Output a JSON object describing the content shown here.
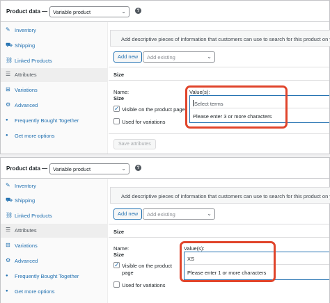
{
  "panels": [
    {
      "title": "Product data —",
      "product_type": "Variable product",
      "tabs": [
        {
          "icon": "wrench-icon",
          "glyph": "✎",
          "label": "Inventory"
        },
        {
          "icon": "truck-icon",
          "glyph": "⛟",
          "label": "Shipping"
        },
        {
          "icon": "link-icon",
          "glyph": "🔗",
          "label": "Linked Products"
        },
        {
          "icon": "list-icon",
          "glyph": "☰",
          "label": "Attributes"
        },
        {
          "icon": "grid-icon",
          "glyph": "⊞",
          "label": "Variations"
        },
        {
          "icon": "gear-icon",
          "glyph": "⚙",
          "label": "Advanced"
        },
        {
          "icon": "plugin-icon",
          "glyph": "⬤",
          "label": "Frequently Bought Together"
        },
        {
          "icon": "plugin-icon",
          "glyph": "⬤",
          "label": "Get more options"
        }
      ],
      "info_text": "Add descriptive pieces of information that customers can use to search for this product on your",
      "add_new": "Add new",
      "add_existing_placeholder": "Add existing",
      "section_title": "Size",
      "name_label": "Name:",
      "name_value": "Size",
      "visible_label": "Visible on the product page",
      "visible_checked": true,
      "variations_label": "Used for variations",
      "variations_checked": false,
      "values_label": "Value(s):",
      "values_input": "Select terms",
      "values_hint": "Please enter 3 or more characters",
      "save_label": "Save attributes"
    },
    {
      "title": "Product data —",
      "product_type": "Variable product",
      "tabs": [
        {
          "icon": "wrench-icon",
          "glyph": "✎",
          "label": "Inventory"
        },
        {
          "icon": "truck-icon",
          "glyph": "⛟",
          "label": "Shipping"
        },
        {
          "icon": "link-icon",
          "glyph": "🔗",
          "label": "Linked Products"
        },
        {
          "icon": "list-icon",
          "glyph": "☰",
          "label": "Attributes"
        },
        {
          "icon": "grid-icon",
          "glyph": "⊞",
          "label": "Variations"
        },
        {
          "icon": "gear-icon",
          "glyph": "⚙",
          "label": "Advanced"
        },
        {
          "icon": "plugin-icon",
          "glyph": "⬤",
          "label": "Frequently Bought Together"
        },
        {
          "icon": "plugin-icon",
          "glyph": "⬤",
          "label": "Get more options"
        }
      ],
      "info_text": "Add descriptive pieces of information that customers can use to search for this product on your",
      "add_new": "Add new",
      "add_existing_placeholder": "Add existing",
      "section_title": "Size",
      "name_label": "Name:",
      "name_value": "Size",
      "visible_label_line1": "Visible on the product",
      "visible_label_line2": "page",
      "visible_checked": true,
      "variations_label": "Used for variations",
      "variations_checked": false,
      "values_label": "Value(s):",
      "values_input": "XS",
      "values_hint": "Please enter 1 or more characters"
    }
  ],
  "colors": {
    "accent": "#2271b1",
    "highlight": "#e0442b"
  }
}
